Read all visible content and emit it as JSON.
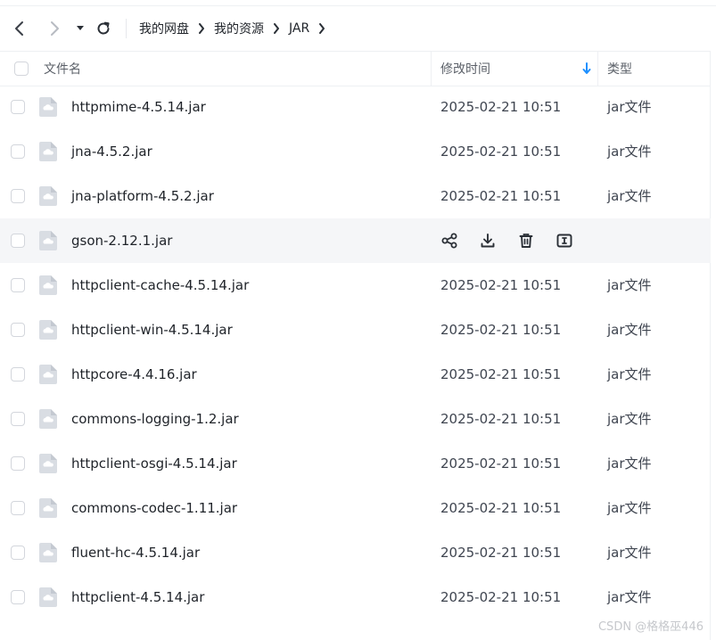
{
  "toolbar": {
    "icons": [
      "back-icon",
      "forward-icon",
      "caret-down-icon",
      "refresh-icon"
    ]
  },
  "breadcrumb": [
    "我的网盘",
    "我的资源",
    "JAR"
  ],
  "columns": {
    "name": "文件名",
    "modified": "修改时间",
    "type": "类型",
    "sort_icon": "sort-down-arrow-icon"
  },
  "colors": {
    "accent": "#1e90ff",
    "hover_row": "#f5f6f8",
    "divider": "#eef0f3"
  },
  "files": [
    {
      "name": "httpmime-4.5.14.jar",
      "modified": "2025-02-21 10:51",
      "type": "jar文件"
    },
    {
      "name": "jna-4.5.2.jar",
      "modified": "2025-02-21 10:51",
      "type": "jar文件"
    },
    {
      "name": "jna-platform-4.5.2.jar",
      "modified": "2025-02-21 10:51",
      "type": "jar文件"
    },
    {
      "name": "gson-2.12.1.jar",
      "modified": "",
      "type": "",
      "hovered": true
    },
    {
      "name": "httpclient-cache-4.5.14.jar",
      "modified": "2025-02-21 10:51",
      "type": "jar文件"
    },
    {
      "name": "httpclient-win-4.5.14.jar",
      "modified": "2025-02-21 10:51",
      "type": "jar文件"
    },
    {
      "name": "httpcore-4.4.16.jar",
      "modified": "2025-02-21 10:51",
      "type": "jar文件"
    },
    {
      "name": "commons-logging-1.2.jar",
      "modified": "2025-02-21 10:51",
      "type": "jar文件"
    },
    {
      "name": "httpclient-osgi-4.5.14.jar",
      "modified": "2025-02-21 10:51",
      "type": "jar文件"
    },
    {
      "name": "commons-codec-1.11.jar",
      "modified": "2025-02-21 10:51",
      "type": "jar文件"
    },
    {
      "name": "fluent-hc-4.5.14.jar",
      "modified": "2025-02-21 10:51",
      "type": "jar文件"
    },
    {
      "name": "httpclient-4.5.14.jar",
      "modified": "2025-02-21 10:51",
      "type": "jar文件"
    }
  ],
  "row_actions": [
    "share-icon",
    "download-icon",
    "delete-icon",
    "rename-icon"
  ],
  "watermark": "CSDN @格格巫446"
}
